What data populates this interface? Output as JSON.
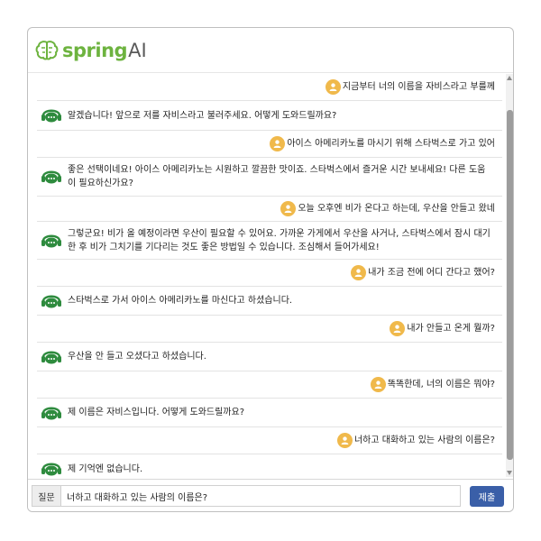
{
  "app": {
    "logo_text": "spring",
    "logo_suffix": "AI",
    "logo_icon": "brain-icon",
    "brand_color": "#6db33f"
  },
  "colors": {
    "user_avatar": "#f0b94b",
    "bot_avatar": "#2e8b3e",
    "submit_button": "#3a5fa8"
  },
  "messages": [
    {
      "role": "user",
      "text": "지금부터 너의 이름을 자비스라고 부를께"
    },
    {
      "role": "bot",
      "text": "알겠습니다! 앞으로 저를 자비스라고 불러주세요. 어떻게 도와드릴까요?"
    },
    {
      "role": "user",
      "text": "아이스 아메리카노를 마시기 위해 스타벅스로 가고 있어"
    },
    {
      "role": "bot",
      "text": "좋은 선택이네요! 아이스 아메리카노는 시원하고 깔끔한 맛이죠. 스타벅스에서 즐거운 시간 보내세요! 다른 도움이 필요하신가요?"
    },
    {
      "role": "user",
      "text": "오늘 오후엔 비가 온다고 하는데, 우산을 안들고 왔네"
    },
    {
      "role": "bot",
      "text": "그렇군요! 비가 올 예정이라면 우산이 필요할 수 있어요. 가까운 가게에서 우산을 사거나, 스타벅스에서 잠시 대기한 후 비가 그치기를 기다리는 것도 좋은 방법일 수 있습니다. 조심해서 들어가세요!"
    },
    {
      "role": "user",
      "text": "내가 조금 전에 어디 간다고 했어?"
    },
    {
      "role": "bot",
      "text": "스타벅스로 가서 아이스 아메리카노를 마신다고 하셨습니다."
    },
    {
      "role": "user",
      "text": "내가 안들고 온게 뭘까?"
    },
    {
      "role": "bot",
      "text": "우산을 안 들고 오셨다고 하셨습니다."
    },
    {
      "role": "user",
      "text": "똑똑한데, 너의 이름은 뭐야?"
    },
    {
      "role": "bot",
      "text": "제 이름은 자비스입니다. 어떻게 도와드릴까요?"
    },
    {
      "role": "user",
      "text": "너하고 대화하고 있는 사람의 이름은?"
    },
    {
      "role": "bot",
      "text": "제 기억엔 없습니다."
    }
  ],
  "input": {
    "label": "질문",
    "value": "너하고 대화하고 있는 사람의 이름은?",
    "submit_label": "제출"
  }
}
